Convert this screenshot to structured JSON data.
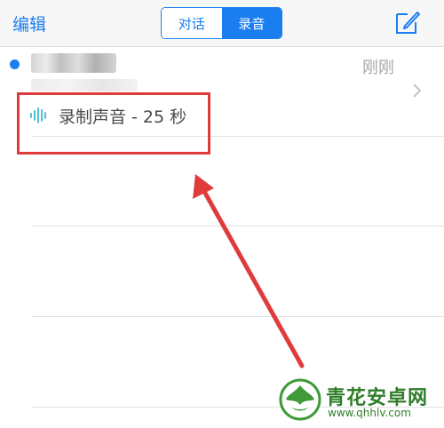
{
  "nav": {
    "edit_label": "编辑",
    "segments": [
      "对话",
      "录音"
    ],
    "selected_segment": "录音",
    "compose_icon": "compose-icon"
  },
  "list": {
    "items": [
      {
        "sender": "",
        "preview": "",
        "unread": true,
        "timestamp": "刚刚",
        "recording_label": "录制声音 - 25 秒"
      }
    ]
  },
  "annotation": {
    "box_color": "#e03b3b",
    "arrow_color": "#e03b3b"
  },
  "watermark": {
    "name": "青花安卓网",
    "url": "www.qhhlv.com"
  },
  "colors": {
    "accent": "#1a7ef0",
    "waveform": "#4fc1d6"
  }
}
